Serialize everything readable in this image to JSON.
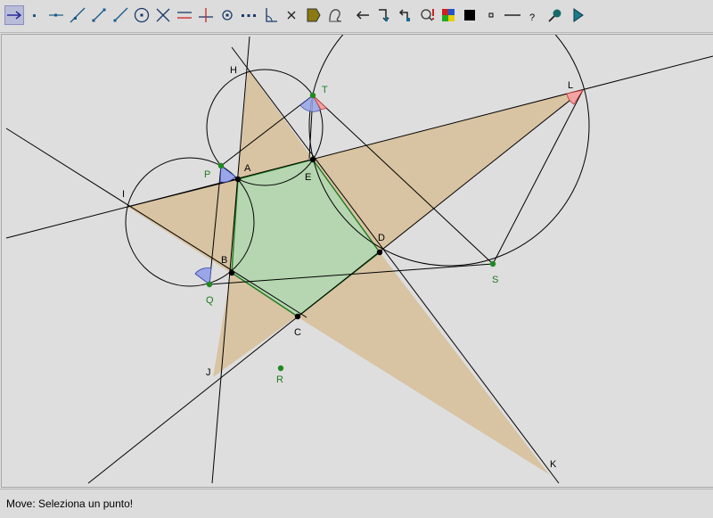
{
  "app": {
    "status_text": "Move: Seleziona un punto!"
  },
  "toolbar": {
    "tools": [
      {
        "name": "move-tool",
        "icon": "move-arrow-icon",
        "selected": true
      },
      {
        "name": "point-tool",
        "icon": "point-icon"
      },
      {
        "name": "point-on-object-tool",
        "icon": "point-on-line-icon"
      },
      {
        "name": "line-tool",
        "icon": "line-icon"
      },
      {
        "name": "segment-tool",
        "icon": "segment-icon"
      },
      {
        "name": "ray-tool",
        "icon": "ray-icon"
      },
      {
        "name": "circle-tool",
        "icon": "circle-icon"
      },
      {
        "name": "intersection-tool",
        "icon": "intersection-icon"
      },
      {
        "name": "parallel-tool",
        "icon": "parallel-icon"
      },
      {
        "name": "perpendicular-tool",
        "icon": "perpendicular-icon"
      },
      {
        "name": "midpoint-tool",
        "icon": "midpoint-icon"
      },
      {
        "name": "dotted-line-tool",
        "icon": "dotted-line-icon"
      },
      {
        "name": "angle-tool",
        "icon": "angle-icon"
      },
      {
        "name": "delete-tool",
        "icon": "delete-x-icon"
      },
      {
        "name": "polygon-tool",
        "icon": "polygon-icon"
      },
      {
        "name": "locus-tool",
        "icon": "locus-icon"
      },
      {
        "name": "undo-tool",
        "icon": "undo-arrow-icon"
      },
      {
        "name": "redo-tool",
        "icon": "redo-arrow-icon"
      },
      {
        "name": "back-tool",
        "icon": "back-arrow-icon"
      },
      {
        "name": "macro-tool",
        "icon": "macro-icon"
      },
      {
        "name": "color-tool",
        "icon": "color-palette-icon"
      },
      {
        "name": "fill-tool",
        "icon": "filled-square-icon"
      },
      {
        "name": "small-point-tool",
        "icon": "small-square-icon"
      },
      {
        "name": "line-style-tool",
        "icon": "line-style-icon"
      },
      {
        "name": "help-tool",
        "icon": "question-mark-icon"
      },
      {
        "name": "zoom-tool",
        "icon": "magnifier-icon"
      },
      {
        "name": "play-tool",
        "icon": "play-icon"
      }
    ]
  },
  "figure": {
    "points": [
      {
        "label": "A",
        "color": "#000000"
      },
      {
        "label": "B",
        "color": "#000000"
      },
      {
        "label": "C",
        "color": "#000000"
      },
      {
        "label": "D",
        "color": "#000000"
      },
      {
        "label": "E",
        "color": "#000000"
      },
      {
        "label": "H",
        "color": "#000000"
      },
      {
        "label": "I",
        "color": "#000000"
      },
      {
        "label": "J",
        "color": "#000000"
      },
      {
        "label": "K",
        "color": "#000000"
      },
      {
        "label": "L",
        "color": "#000000"
      },
      {
        "label": "P",
        "color": "#1f7a1f"
      },
      {
        "label": "Q",
        "color": "#1f7a1f"
      },
      {
        "label": "R",
        "color": "#1f7a1f"
      },
      {
        "label": "S",
        "color": "#1f7a1f"
      },
      {
        "label": "T",
        "color": "#1f7a1f"
      }
    ],
    "colors": {
      "pentagon_fill": "#b5d6b0",
      "pentagon_stroke": "#1e7a1e",
      "star_fill": "#d8c3a2",
      "line": "#000000",
      "angle_blue": "#9aa6e8",
      "angle_red": "#f2a3a3",
      "green_point": "#1f8a1f"
    }
  }
}
